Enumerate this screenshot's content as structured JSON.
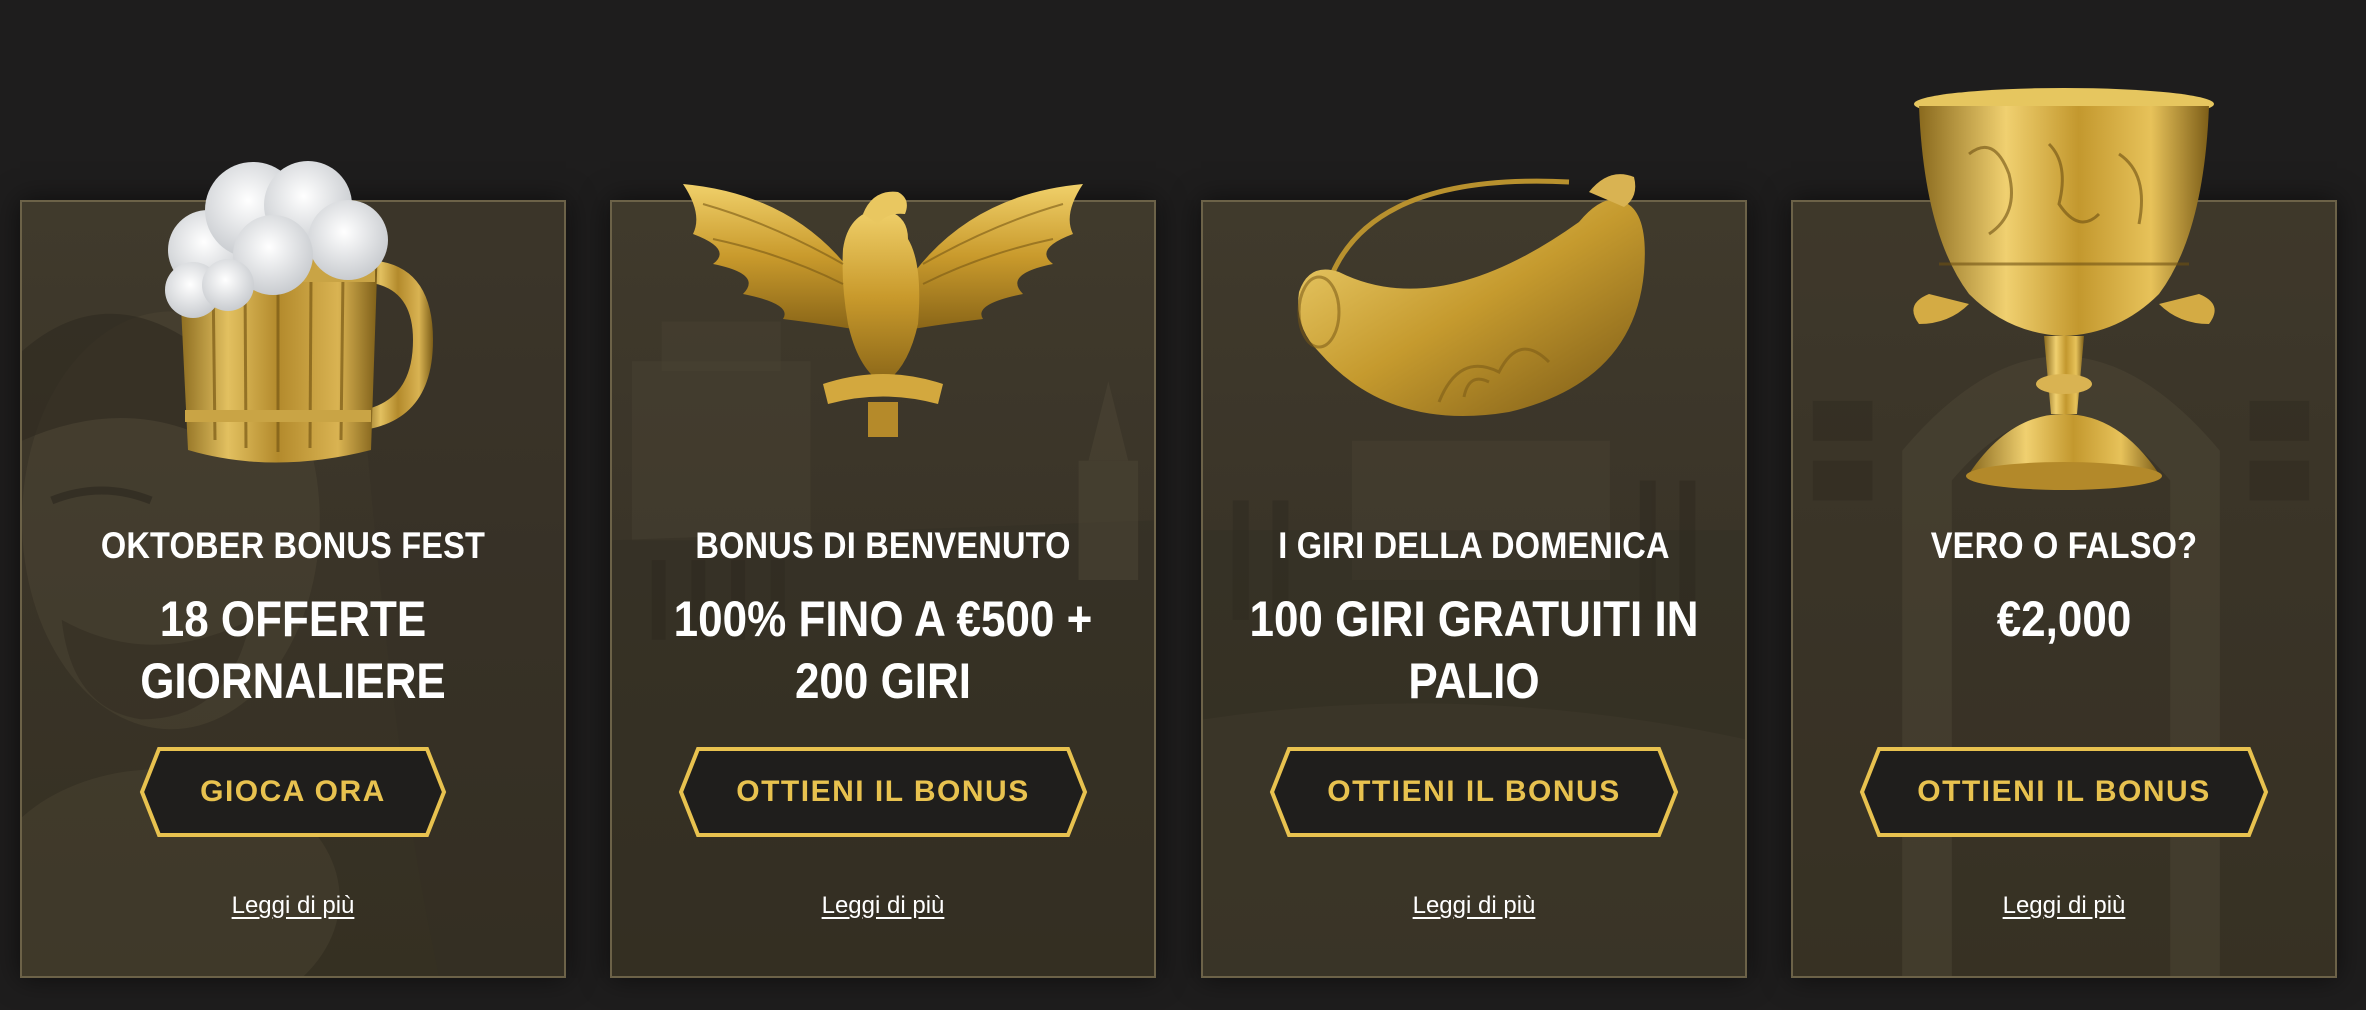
{
  "colors": {
    "page_background": "#1e1d1d",
    "card_background": "#3c3629",
    "card_border": "#6c6248",
    "accent_gold": "#e8c24f",
    "button_fill": "#1f1e1c",
    "text_white": "#ffffff"
  },
  "cards": [
    {
      "art_icon": "beer-mug-icon",
      "subtitle": "OKTOBER BONUS FEST",
      "title_line1": "18 OFFERTE",
      "title_line2": "GIORNALIERE",
      "button_label": "GIOCA ORA",
      "link_label": "Leggi di più"
    },
    {
      "art_icon": "golden-eagle-icon",
      "subtitle": "BONUS DI BENVENUTO",
      "title_line1": "100% FINO A €500 +",
      "title_line2": "200 GIRI",
      "button_label": "OTTIENI IL BONUS",
      "link_label": "Leggi di più"
    },
    {
      "art_icon": "golden-horn-icon",
      "subtitle": "I GIRI DELLA DOMENICA",
      "title_line1": "100 GIRI GRATUITI IN",
      "title_line2": "PALIO",
      "button_label": "OTTIENI IL BONUS",
      "link_label": "Leggi di più"
    },
    {
      "art_icon": "golden-chalice-icon",
      "subtitle": "VERO O FALSO?",
      "title_line1": "€2,000",
      "title_line2": "",
      "button_label": "OTTIENI IL BONUS",
      "link_label": "Leggi di più"
    }
  ]
}
